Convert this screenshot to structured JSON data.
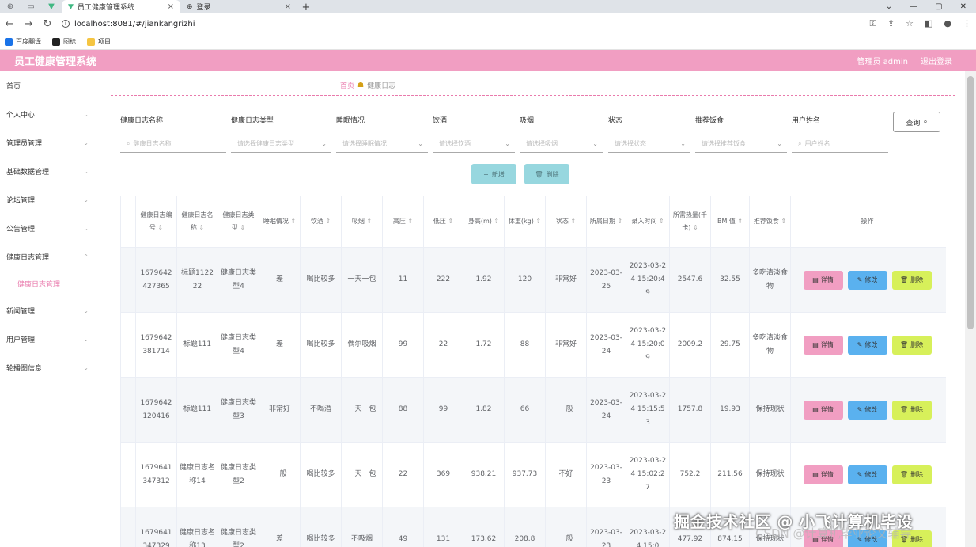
{
  "browser": {
    "tabs": [
      {
        "title": "员工健康管理系统",
        "active": true
      },
      {
        "title": "登录",
        "active": false
      }
    ],
    "url": "localhost:8081/#/jiankangrizhi",
    "bookmarks": [
      "百度翻译",
      "图标",
      "项目"
    ],
    "bookmark_colors": [
      "#1a73e8",
      "#222222",
      "#f5c542"
    ]
  },
  "header": {
    "title": "员工健康管理系统",
    "admin": "管理员 admin",
    "logout": "退出登录"
  },
  "sidebar": {
    "items": [
      {
        "label": "首页",
        "has_sub": false
      },
      {
        "label": "个人中心",
        "has_sub": true
      },
      {
        "label": "管理员管理",
        "has_sub": true
      },
      {
        "label": "基础数据管理",
        "has_sub": true
      },
      {
        "label": "论坛管理",
        "has_sub": true
      },
      {
        "label": "公告管理",
        "has_sub": true
      },
      {
        "label": "健康日志管理",
        "has_sub": true
      },
      {
        "label": "新闻管理",
        "has_sub": true
      },
      {
        "label": "用户管理",
        "has_sub": true
      },
      {
        "label": "轮播图信息",
        "has_sub": true
      }
    ],
    "sub_active": "健康日志管理"
  },
  "breadcrumb": {
    "home": "首页",
    "current": "健康日志"
  },
  "filters": [
    {
      "label": "健康日志名称",
      "placeholder": "健康日志名称",
      "type": "search"
    },
    {
      "label": "健康日志类型",
      "placeholder": "请选择健康日志类型",
      "type": "select"
    },
    {
      "label": "睡眠情况",
      "placeholder": "请选择睡眠情况",
      "type": "select"
    },
    {
      "label": "饮酒",
      "placeholder": "请选择饮酒",
      "type": "select"
    },
    {
      "label": "吸烟",
      "placeholder": "请选择吸烟",
      "type": "select"
    },
    {
      "label": "状态",
      "placeholder": "请选择状态",
      "type": "select"
    },
    {
      "label": "推荐饭食",
      "placeholder": "请选择推荐饭食",
      "type": "select"
    },
    {
      "label": "用户姓名",
      "placeholder": "用户姓名",
      "type": "search"
    }
  ],
  "query_label": "查询",
  "add_label": "新增",
  "delete_label": "删除",
  "table": {
    "columns": [
      "健康日志编号",
      "健康日志名称",
      "健康日志类型",
      "睡眠情况",
      "饮酒",
      "吸烟",
      "高压",
      "低压",
      "身高(m)",
      "体重(kg)",
      "状态",
      "所属日期",
      "录入时间",
      "所需热量(千卡)",
      "BMI值",
      "推荐饭食",
      "操作"
    ],
    "rows": [
      [
        "1679642427365",
        "标题112222",
        "健康日志类型4",
        "差",
        "喝比较多",
        "一天一包",
        "11",
        "222",
        "1.92",
        "120",
        "非常好",
        "2023-03-25",
        "2023-03-24 15:20:49",
        "2547.6",
        "32.55",
        "多吃清淡食物"
      ],
      [
        "1679642381714",
        "标题111",
        "健康日志类型4",
        "差",
        "喝比较多",
        "偶尔吸烟",
        "99",
        "22",
        "1.72",
        "88",
        "非常好",
        "2023-03-24",
        "2023-03-24 15:20:09",
        "2009.2",
        "29.75",
        "多吃清淡食物"
      ],
      [
        "1679642120416",
        "标题111",
        "健康日志类型3",
        "非常好",
        "不喝酒",
        "一天一包",
        "88",
        "99",
        "1.82",
        "66",
        "一般",
        "2023-03-24",
        "2023-03-24 15:15:53",
        "1757.8",
        "19.93",
        "保持现状"
      ],
      [
        "1679641347312",
        "健康日志名称14",
        "健康日志类型2",
        "一般",
        "喝比较多",
        "一天一包",
        "22",
        "369",
        "938.21",
        "937.73",
        "不好",
        "2023-03-23",
        "2023-03-24 15:02:27",
        "752.2",
        "211.56",
        "保持现状"
      ],
      [
        "1679641347329",
        "健康日志名称13",
        "健康日志类型2",
        "差",
        "喝比较多",
        "不吸烟",
        "49",
        "131",
        "173.62",
        "208.8",
        "一般",
        "2023-03-23",
        "2023-03-24 15:0",
        "477.92",
        "874.15",
        "保持现状"
      ]
    ],
    "ops": {
      "detail": "详情",
      "edit": "修改",
      "delete": "删除"
    }
  },
  "watermark": "掘金技术社区 @ 小飞计算机毕设",
  "watermark2": "CSDN @计算机毕业论文辅导"
}
